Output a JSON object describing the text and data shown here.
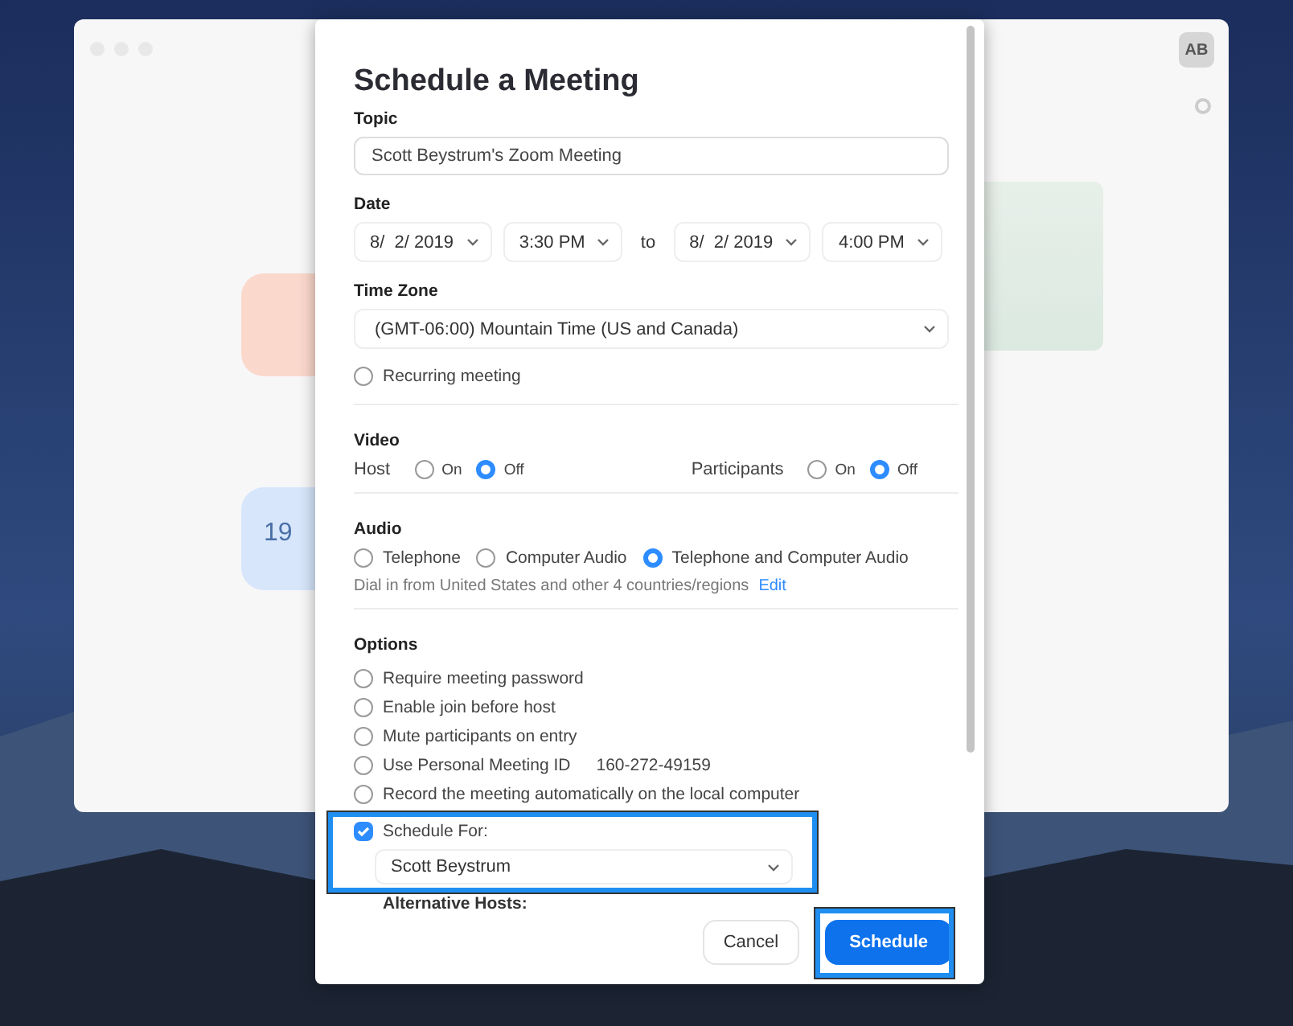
{
  "app_window": {
    "avatar": "AB",
    "calendar_day": "19"
  },
  "dialog": {
    "title": "Schedule a Meeting",
    "topic": {
      "label": "Topic",
      "value": "Scott Beystrum's Zoom Meeting"
    },
    "date": {
      "label": "Date",
      "start_date": "8/  2/ 2019",
      "start_time": "3:30 PM",
      "connector": "to",
      "end_date": "8/  2/ 2019",
      "end_time": "4:00 PM"
    },
    "time_zone": {
      "label": "Time Zone",
      "value": "(GMT-06:00) Mountain Time (US and Canada)"
    },
    "recurring": {
      "label": "Recurring meeting",
      "checked": false
    },
    "video": {
      "label": "Video",
      "groups": [
        {
          "label": "Host",
          "options": [
            {
              "label": "On",
              "selected": false
            },
            {
              "label": "Off",
              "selected": true
            }
          ]
        },
        {
          "label": "Participants",
          "options": [
            {
              "label": "On",
              "selected": false
            },
            {
              "label": "Off",
              "selected": true
            }
          ]
        }
      ]
    },
    "audio": {
      "label": "Audio",
      "options": [
        {
          "label": "Telephone",
          "selected": false
        },
        {
          "label": "Computer Audio",
          "selected": false
        },
        {
          "label": "Telephone and Computer Audio",
          "selected": true
        }
      ],
      "dial_in_text": "Dial in from United States and other 4 countries/regions",
      "edit_link": "Edit"
    },
    "options": {
      "label": "Options",
      "items": [
        {
          "label": "Require meeting password",
          "checked": false
        },
        {
          "label": "Enable join before host",
          "checked": false
        },
        {
          "label": "Mute participants on entry",
          "checked": false
        },
        {
          "label": "Use Personal Meeting ID",
          "detail": "160-272-49159",
          "checked": false
        },
        {
          "label": "Record the meeting automatically on the local computer",
          "checked": false
        }
      ]
    },
    "schedule_for": {
      "label": "Schedule For:",
      "checked": true,
      "value": "Scott Beystrum",
      "highlighted": true
    },
    "alternative_hosts": {
      "label": "Alternative Hosts:"
    },
    "buttons": [
      {
        "label": "Cancel",
        "kind": "secondary",
        "highlighted": false
      },
      {
        "label": "Schedule",
        "kind": "primary",
        "highlighted": true
      }
    ]
  }
}
